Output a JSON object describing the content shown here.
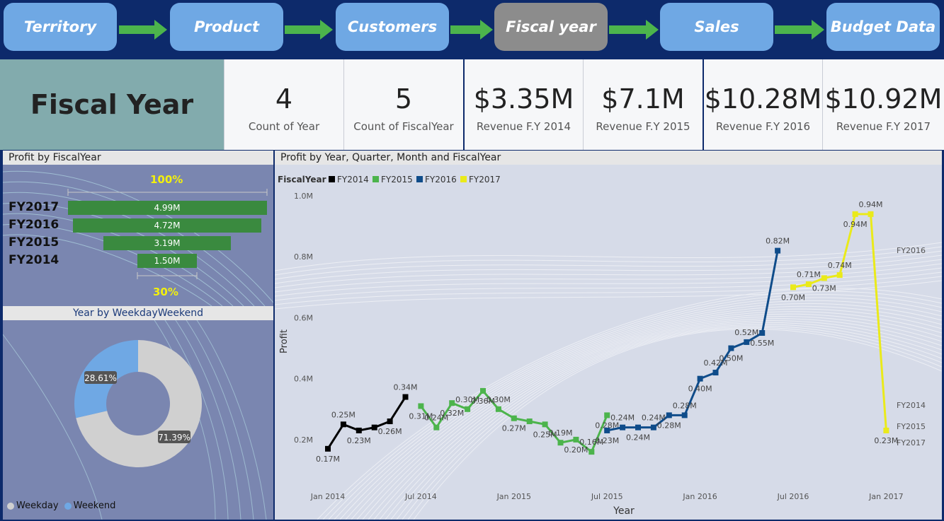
{
  "nav": {
    "items": [
      {
        "label": "Territory"
      },
      {
        "label": "Product"
      },
      {
        "label": "Customers"
      },
      {
        "label": "Fiscal year"
      },
      {
        "label": "Sales"
      },
      {
        "label": "Budget Data"
      }
    ],
    "active_index": 3
  },
  "header": {
    "title": "Fiscal Year"
  },
  "cards": [
    {
      "value": "4",
      "label": "Count of Year"
    },
    {
      "value": "5",
      "label": "Count of FiscalYear"
    },
    {
      "value": "$3.35M",
      "label": "Revenue F.Y 2014"
    },
    {
      "value": "$7.1M",
      "label": "Revenue F.Y 2015"
    },
    {
      "value": "$10.28M",
      "label": "Revenue F.Y 2016"
    },
    {
      "value": "$10.92M",
      "label": "Revenue F.Y 2017"
    }
  ],
  "colors": {
    "fy2014": "#000000",
    "fy2015": "#4cb44c",
    "fy2016": "#0f4c8a",
    "fy2017": "#eaea1a",
    "weekday": "#d0d0d0",
    "weekend": "#6fa8e4",
    "bar": "#3a8a3f"
  },
  "funnel": {
    "title": "Profit by FiscalYear",
    "top_pct": "100%",
    "bottom_pct": "30%",
    "chart_data": {
      "type": "bar",
      "categories": [
        "FY2017",
        "FY2016",
        "FY2015",
        "FY2014"
      ],
      "values": [
        4.99,
        4.72,
        3.19,
        1.5
      ],
      "labels": [
        "4.99M",
        "4.72M",
        "3.19M",
        "1.50M"
      ]
    }
  },
  "donut": {
    "title": "Year by WeekdayWeekend",
    "legend": [
      {
        "name": "Weekday"
      },
      {
        "name": "Weekend"
      }
    ],
    "chart_data": {
      "type": "pie",
      "categories": [
        "Weekday",
        "Weekend"
      ],
      "values": [
        71.39,
        28.61
      ],
      "labels": [
        "71.39%",
        "28.61%"
      ]
    }
  },
  "line": {
    "title": "Profit by Year, Quarter, Month and FiscalYear",
    "legend_title": "FiscalYear",
    "ylabel": "Profit",
    "xlabel": "Year",
    "yticks": [
      "1.0M",
      "0.8M",
      "0.6M",
      "0.4M",
      "0.2M"
    ],
    "xticks": [
      "Jan 2014",
      "Jul 2014",
      "Jan 2015",
      "Jul 2015",
      "Jan 2016",
      "Jul 2016",
      "Jan 2017"
    ],
    "series_end_labels": [
      "FY2016",
      "FY2014",
      "FY2015",
      "FY2017"
    ],
    "chart_data": {
      "type": "line",
      "ylim": [
        0.1,
        1.0
      ],
      "series": [
        {
          "name": "FY2014",
          "x": [
            "2014-01",
            "2014-02",
            "2014-03",
            "2014-04",
            "2014-05",
            "2014-06"
          ],
          "values": [
            0.17,
            0.25,
            0.23,
            0.24,
            0.26,
            0.34
          ],
          "labels": [
            "0.17M",
            "0.25M",
            "0.23M",
            "",
            "0.26M",
            "0.34M"
          ]
        },
        {
          "name": "FY2015",
          "x": [
            "2014-07",
            "2014-08",
            "2014-09",
            "2014-10",
            "2014-11",
            "2014-12",
            "2015-01",
            "2015-02",
            "2015-03",
            "2015-04",
            "2015-05",
            "2015-06",
            "2015-07"
          ],
          "values": [
            0.31,
            0.24,
            0.32,
            0.3,
            0.36,
            0.3,
            0.27,
            0.26,
            0.25,
            0.19,
            0.2,
            0.16,
            0.28
          ],
          "labels": [
            "0.31M",
            "0.24M",
            "0.32M",
            "0.30M",
            "0.36M",
            "0.30M",
            "0.27M",
            "",
            "0.25M",
            "0.19M",
            "0.20M",
            "0.16M",
            "0.28M"
          ]
        },
        {
          "name": "FY2016",
          "x": [
            "2015-07",
            "2015-08",
            "2015-09",
            "2015-10",
            "2015-11",
            "2015-12",
            "2016-01",
            "2016-02",
            "2016-03",
            "2016-04",
            "2016-05",
            "2016-06"
          ],
          "values": [
            0.23,
            0.24,
            0.24,
            0.24,
            0.28,
            0.28,
            0.4,
            0.42,
            0.5,
            0.52,
            0.55,
            0.82
          ],
          "labels": [
            "0.23M",
            "0.24M",
            "0.24M",
            "0.24M",
            "0.28M",
            "0.28M",
            "0.40M",
            "0.42M",
            "0.50M",
            "0.52M",
            "0.55M",
            "0.82M"
          ]
        },
        {
          "name": "FY2017",
          "x": [
            "2016-07",
            "2016-08",
            "2016-09",
            "2016-10",
            "2016-11",
            "2016-12",
            "2017-01"
          ],
          "values": [
            0.7,
            0.71,
            0.73,
            0.74,
            0.94,
            0.94,
            0.23
          ],
          "labels": [
            "0.70M",
            "0.71M",
            "0.73M",
            "0.74M",
            "0.94M",
            "0.94M",
            "0.23M"
          ]
        }
      ]
    }
  }
}
